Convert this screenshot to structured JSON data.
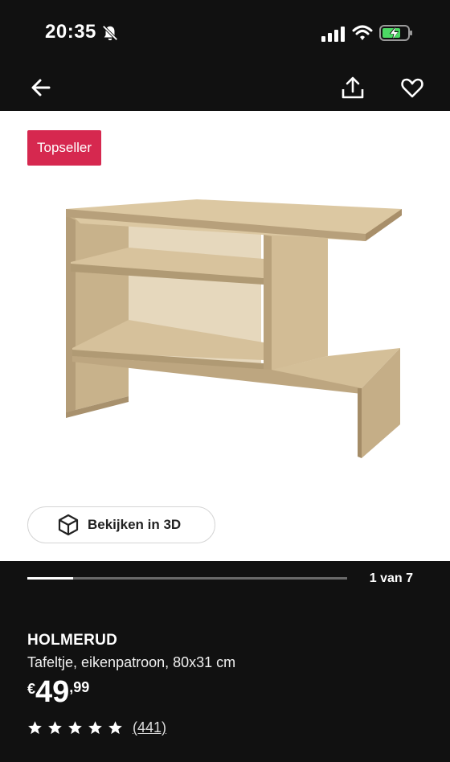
{
  "status_bar": {
    "time": "20:35"
  },
  "hero": {
    "badge": "Topseller",
    "view_3d_label": "Bekijken in 3D"
  },
  "gallery": {
    "page_indicator": "1 van 7",
    "progress_fraction": 0.143
  },
  "product": {
    "name": "HOLMERUD",
    "description": "Tafeltje, eikenpatroon, 80x31 cm",
    "price_currency": "€",
    "price_whole": "49",
    "price_cents": ",99",
    "rating_stars": 5,
    "review_count": "(441)"
  },
  "colors": {
    "badge": "#d6284f",
    "background": "#111111",
    "battery_fill": "#4cd964"
  },
  "icons": [
    "mute-icon",
    "signal-icon",
    "wifi-icon",
    "battery-charging-icon",
    "arrow-left-icon",
    "share-icon",
    "heart-icon",
    "cube-3d-icon",
    "star-icon"
  ]
}
